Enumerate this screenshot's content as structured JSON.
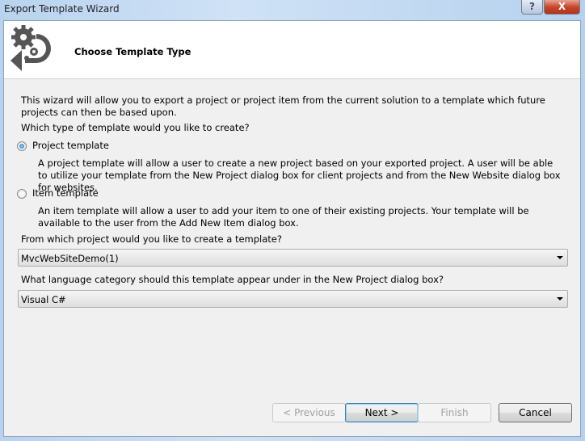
{
  "window": {
    "title": "Export Template Wizard",
    "help": "?",
    "close": "X"
  },
  "header": {
    "title": "Choose Template Type",
    "icon": "gears-arrow-icon"
  },
  "intro": "This wizard will allow you to export a project or project item from the current solution to a template which future projects can then be based upon.",
  "question_type": "Which type of template would you like to create?",
  "options": [
    {
      "label": "Project template",
      "selected": true,
      "description": "A project template will allow a user to create a new project based on your exported project. A user will be able to utilize your template from the New Project dialog box for client projects and from the New Website dialog box for websites."
    },
    {
      "label": "Item template",
      "selected": false,
      "description": "An item template will allow a user to add your item to one of their existing projects. Your template will be available to the user from the Add New Item dialog box."
    }
  ],
  "project_question": "From which project would you like to create a template?",
  "project_value": "MvcWebSiteDemo(1)",
  "language_question": "What language category should this template appear under in the New Project dialog box?",
  "language_value": "Visual C#",
  "buttons": {
    "previous": "< Previous",
    "next": "Next >",
    "finish": "Finish",
    "cancel": "Cancel"
  }
}
